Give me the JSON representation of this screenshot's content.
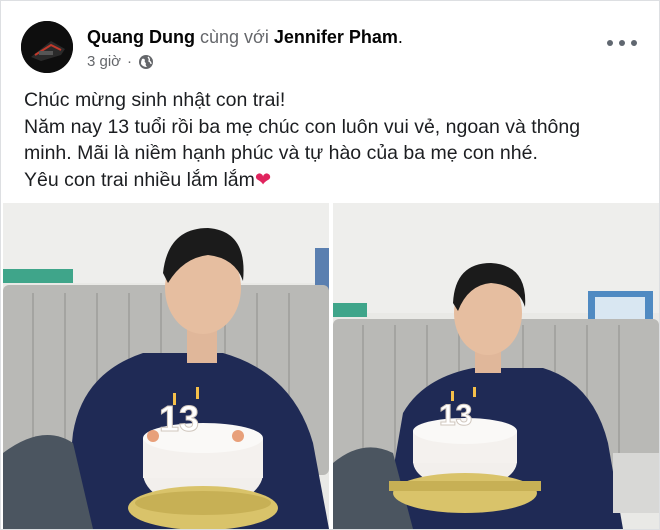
{
  "post": {
    "author": "Quang Dung",
    "with_text": "cùng với",
    "tagged": "Jennifer Pham",
    "period": ".",
    "time": "3 giờ",
    "separator": "·",
    "text_lines": [
      "Chúc mừng sinh nhật con trai!",
      "Năm nay 13 tuổi rồi ba mẹ chúc con luôn vui vẻ, ngoan và thông",
      "minh.  Mãi là niềm hạnh phúc và tự hào của ba mẹ con nhé.",
      "Yêu con trai nhiều lắm lắm"
    ],
    "heart_emoji": "❤"
  },
  "icons": {
    "privacy": "globe-icon",
    "menu": "more-options-icon"
  },
  "photos": {
    "candle_number": "13"
  },
  "colors": {
    "secondary_text": "#65676b",
    "heart": "#e0245e",
    "shirt": "#1f2a55",
    "sofa": "#b9b9b6"
  }
}
